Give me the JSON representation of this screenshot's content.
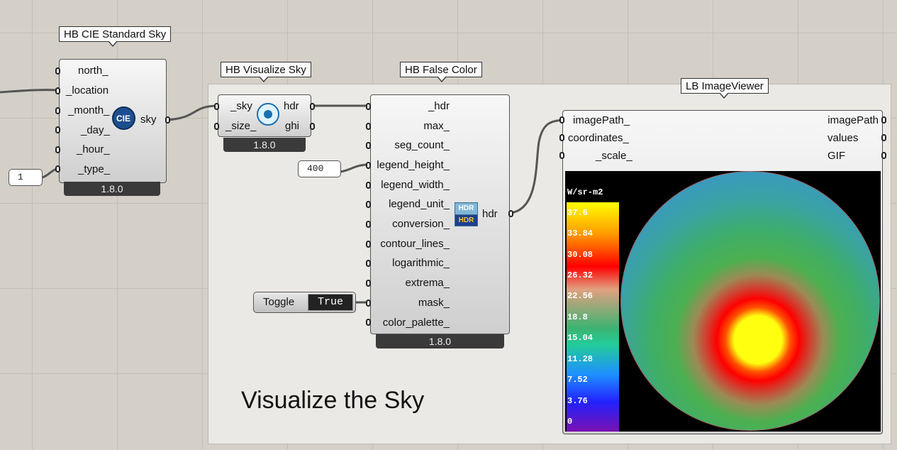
{
  "group": {
    "title": "Visualize the Sky"
  },
  "cie_sky": {
    "tag": "HB CIE Standard Sky",
    "inputs": [
      "north_",
      "_location",
      "_month_",
      "_day_",
      "_hour_",
      "_type_"
    ],
    "output": "sky",
    "icon_text": "CIE",
    "version": "1.8.0"
  },
  "visualize_sky": {
    "tag": "HB Visualize Sky",
    "inputs": [
      "_sky",
      "_size_"
    ],
    "outputs": [
      "hdr",
      "ghi"
    ],
    "version": "1.8.0"
  },
  "false_color": {
    "tag": "HB False Color",
    "inputs": [
      "_hdr",
      "max_",
      "seg_count_",
      "legend_height_",
      "legend_width_",
      "legend_unit_",
      "conversion_",
      "contour_lines_",
      "logarithmic_",
      "extrema_",
      "mask_",
      "color_palette_"
    ],
    "output": "hdr",
    "icon_text_top": "HDR",
    "icon_text_bottom": "HDR",
    "version": "1.8.0"
  },
  "image_viewer": {
    "tag": "LB ImageViewer",
    "inputs": [
      "imagePath_",
      "coordinates_",
      "_scale_"
    ],
    "outputs": [
      "imagePath",
      "values",
      "GIF"
    ],
    "legend_title": "W/sr-m2",
    "legend_values": [
      "37.6",
      "33.84",
      "30.08",
      "26.32",
      "22.56",
      "18.8",
      "15.04",
      "11.28",
      "7.52",
      "3.76",
      "0"
    ]
  },
  "sliders": {
    "type_value": "1",
    "legend_height_value": "400"
  },
  "toggle": {
    "label": "Toggle",
    "value": "True"
  }
}
